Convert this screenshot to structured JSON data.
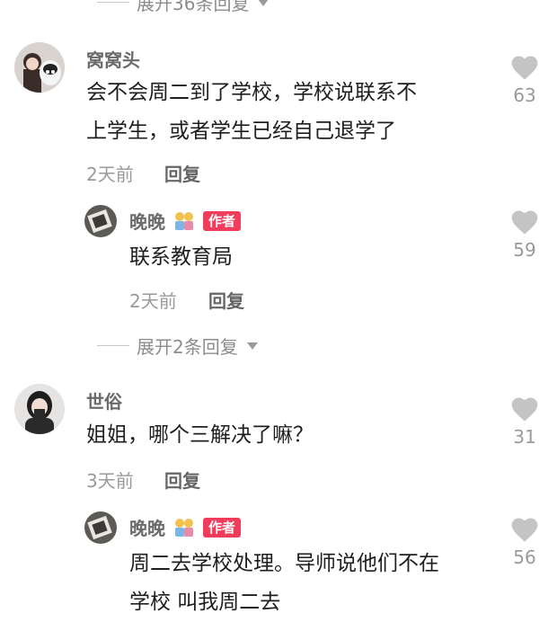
{
  "top_expand": {
    "label": "展开36条回复"
  },
  "comments": [
    {
      "username": "窝窝头",
      "text_lines": [
        "会不会周二到了学校，学校说联系不",
        "上学生，或者学生已经自己退学了"
      ],
      "time": "2天前",
      "reply_label": "回复",
      "likes": "63",
      "reply": {
        "username": "晚晚",
        "badge": "作者",
        "text_lines": [
          "联系教育局"
        ],
        "time": "2天前",
        "reply_label": "回复",
        "likes": "59"
      },
      "expand": {
        "label": "展开2条回复"
      }
    },
    {
      "username": "世俗",
      "text_lines": [
        "姐姐，哪个三解决了嘛？"
      ],
      "time": "3天前",
      "reply_label": "回复",
      "likes": "31",
      "reply": {
        "username": "晚晚",
        "badge": "作者",
        "text_lines": [
          "周二去学校处理。导师说他们不在",
          "学校 叫我周二去"
        ],
        "likes": "56"
      }
    }
  ],
  "colors": {
    "badge": "#f23c5c",
    "like_icon": "#c4c4c4",
    "meta_text": "#9a9a9a"
  }
}
